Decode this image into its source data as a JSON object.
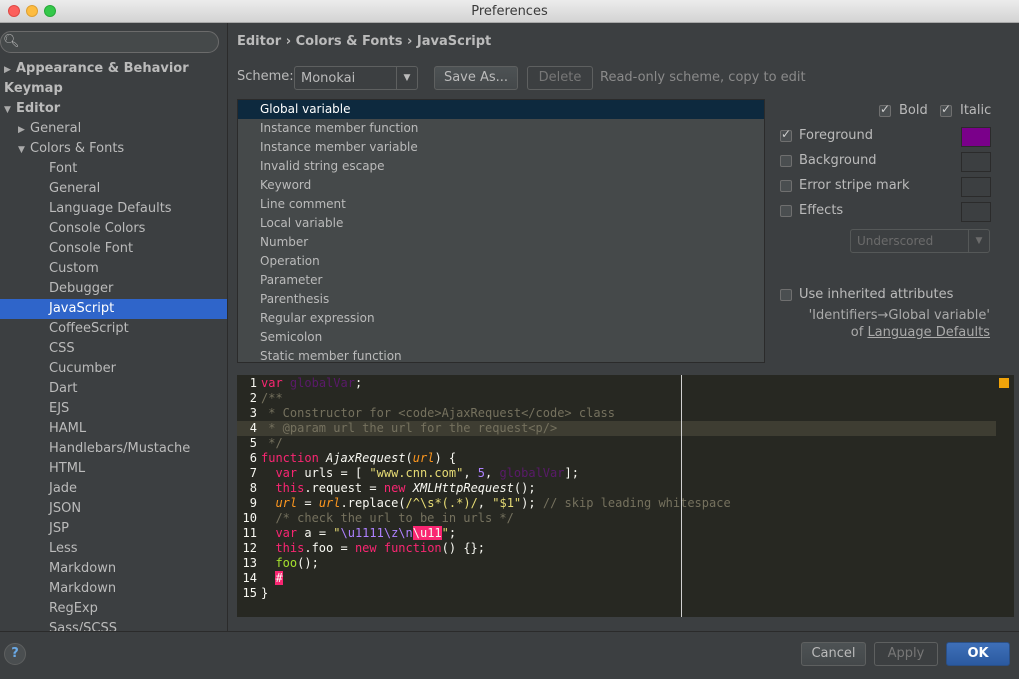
{
  "window": {
    "title": "Preferences",
    "traffic_lights": [
      "close",
      "minimize",
      "zoom"
    ]
  },
  "sidebar": {
    "search_placeholder": "",
    "items": [
      {
        "label": "Appearance & Behavior",
        "arrow": "▶",
        "bold": true
      },
      {
        "label": "Keymap",
        "bold": true
      },
      {
        "label": "Editor",
        "arrow": "▼",
        "bold": true
      },
      {
        "label": "General",
        "arrow": "▶"
      },
      {
        "label": "Colors & Fonts",
        "arrow": "▼"
      },
      {
        "label": "Font"
      },
      {
        "label": "General"
      },
      {
        "label": "Language Defaults"
      },
      {
        "label": "Console Colors"
      },
      {
        "label": "Console Font"
      },
      {
        "label": "Custom"
      },
      {
        "label": "Debugger"
      },
      {
        "label": "JavaScript",
        "selected": true
      },
      {
        "label": "CoffeeScript"
      },
      {
        "label": "CSS"
      },
      {
        "label": "Cucumber"
      },
      {
        "label": "Dart"
      },
      {
        "label": "EJS"
      },
      {
        "label": "HAML"
      },
      {
        "label": "Handlebars/Mustache"
      },
      {
        "label": "HTML"
      },
      {
        "label": "Jade"
      },
      {
        "label": "JSON"
      },
      {
        "label": "JSP"
      },
      {
        "label": "Less"
      },
      {
        "label": "Markdown"
      },
      {
        "label": "Markdown"
      },
      {
        "label": "RegExp"
      },
      {
        "label": "Sass/SCSS"
      }
    ]
  },
  "main": {
    "breadcrumb": "Editor › Colors & Fonts › JavaScript",
    "scheme_label": "Scheme:",
    "scheme_value": "Monokai",
    "save_as_label": "Save As...",
    "delete_label": "Delete",
    "readonly_hint": "Read-only scheme, copy to edit",
    "elements": [
      {
        "label": "Global variable",
        "selected": true
      },
      {
        "label": "Instance member function"
      },
      {
        "label": "Instance member variable"
      },
      {
        "label": "Invalid string escape"
      },
      {
        "label": "Keyword"
      },
      {
        "label": "Line comment"
      },
      {
        "label": "Local variable"
      },
      {
        "label": "Number"
      },
      {
        "label": "Operation"
      },
      {
        "label": "Parameter"
      },
      {
        "label": "Parenthesis"
      },
      {
        "label": "Regular expression"
      },
      {
        "label": "Semicolon"
      },
      {
        "label": "Static member function"
      }
    ],
    "attributes": {
      "bold_label": "Bold",
      "bold_checked": true,
      "italic_label": "Italic",
      "italic_checked": true,
      "foreground_label": "Foreground",
      "foreground_checked": true,
      "foreground_color": "#7a008a",
      "background_label": "Background",
      "background_checked": false,
      "error_stripe_label": "Error stripe mark",
      "error_stripe_checked": false,
      "effects_label": "Effects",
      "effects_checked": false,
      "effects_type": "Underscored",
      "inherit_label": "Use inherited attributes",
      "inherit_checked": false,
      "inherit_note_line1": "'Identifiers→Global variable'",
      "inherit_note_of": "of",
      "inherit_note_link": "Language Defaults"
    },
    "preview": {
      "line_numbers": [
        "1",
        "2",
        "3",
        "4",
        "5",
        "6",
        "7",
        "8",
        "9",
        "10",
        "11",
        "12",
        "13",
        "14",
        "15"
      ],
      "highlighted_line": 4,
      "marker_color": "#f0a30a"
    }
  },
  "footer": {
    "help_label": "?",
    "cancel_label": "Cancel",
    "apply_label": "Apply",
    "ok_label": "OK"
  }
}
